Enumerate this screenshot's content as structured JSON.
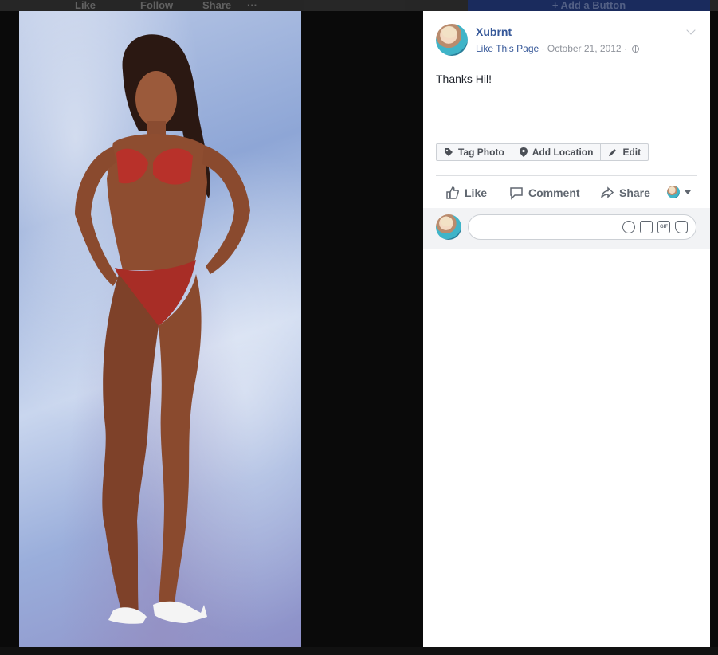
{
  "background_page": {
    "like_label": "Like",
    "follow_label": "Follow",
    "share_label": "Share",
    "more_label": "···",
    "add_button_label": "+ Add a Button"
  },
  "post": {
    "author": "Xubrnt",
    "like_page_label": "Like This Page",
    "date": "October 21, 2012",
    "separator": "·",
    "caption": "Thanks Hil!"
  },
  "photo_actions": {
    "tag_photo": "Tag Photo",
    "add_location": "Add Location",
    "edit": "Edit"
  },
  "ufi": {
    "like": "Like",
    "comment": "Comment",
    "share": "Share"
  },
  "comment_box": {
    "placeholder": "",
    "gif_text": "GIF"
  },
  "icons": {
    "tag": "tag-icon",
    "location": "location-pin-icon",
    "edit": "pencil-icon",
    "like": "thumbs-up-icon",
    "comment": "speech-bubble-icon",
    "share": "share-arrow-icon",
    "privacy": "globe-icon",
    "options": "chevron-down-icon"
  },
  "colors": {
    "link": "#365899",
    "meta": "#90949c",
    "action_text": "#606770"
  }
}
